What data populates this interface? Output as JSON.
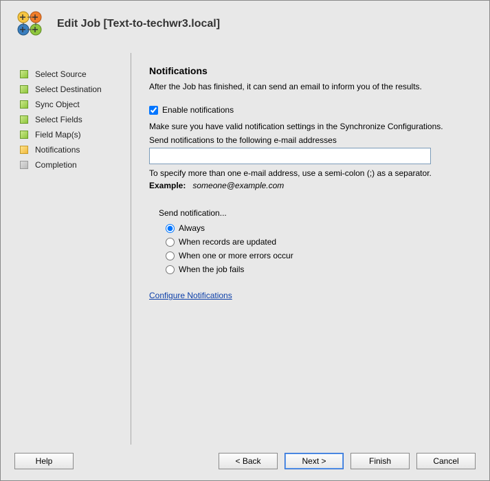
{
  "header": {
    "title": "Edit Job [Text-to-techwr3.local]"
  },
  "sidebar": {
    "items": [
      {
        "label": "Select Source",
        "state": "done"
      },
      {
        "label": "Select Destination",
        "state": "done"
      },
      {
        "label": "Sync Object",
        "state": "done"
      },
      {
        "label": "Select Fields",
        "state": "done"
      },
      {
        "label": "Field Map(s)",
        "state": "done"
      },
      {
        "label": "Notifications",
        "state": "current"
      },
      {
        "label": "Completion",
        "state": "inactive"
      }
    ]
  },
  "content": {
    "heading": "Notifications",
    "description": "After the Job has finished, it can send an email to inform you of the results.",
    "enable_label": "Enable notifications",
    "enable_checked": true,
    "config_hint": "Make sure you have valid notification settings in the Synchronize Configurations.",
    "field_label": "Send notifications to the following e-mail addresses",
    "email_value": "",
    "multi_hint": "To specify more than one e-mail address, use a semi-colon (;) as a separator.",
    "example_label": "Example:",
    "example_value": "someone@example.com",
    "radio_title": "Send notification...",
    "radio_options": [
      {
        "label": "Always",
        "checked": true
      },
      {
        "label": "When records are updated",
        "checked": false
      },
      {
        "label": "When one or more errors occur",
        "checked": false
      },
      {
        "label": "When the job fails",
        "checked": false
      }
    ],
    "configure_link": "Configure Notifications"
  },
  "footer": {
    "help": "Help",
    "back": "< Back",
    "next": "Next >",
    "finish": "Finish",
    "cancel": "Cancel"
  }
}
